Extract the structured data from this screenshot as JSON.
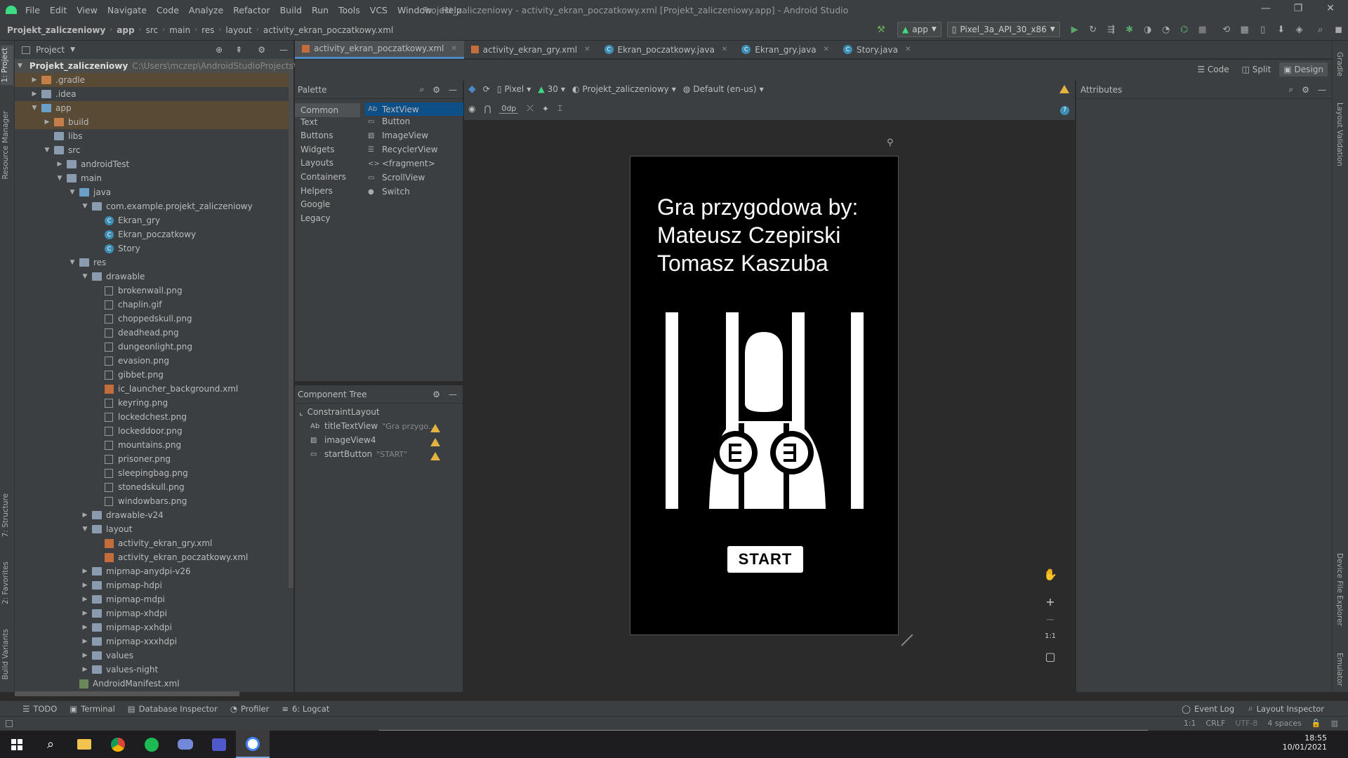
{
  "window": {
    "menu": [
      "File",
      "Edit",
      "View",
      "Navigate",
      "Code",
      "Analyze",
      "Refactor",
      "Build",
      "Run",
      "Tools",
      "VCS",
      "Window",
      "Help"
    ],
    "title": "Projekt_zaliczeniowy - activity_ekran_poczatkowy.xml [Projekt_zaliczeniowy.app] - Android Studio"
  },
  "navbar": {
    "breadcrumbs": [
      "Projekt_zaliczeniowy",
      "app",
      "src",
      "main",
      "res",
      "layout",
      "activity_ekran_poczatkowy.xml"
    ],
    "run_config": "app",
    "device": "Pixel_3a_API_30_x86"
  },
  "left_strip": {
    "project": "1: Project",
    "resource_manager": "Resource Manager",
    "structure": "7: Structure",
    "favorites": "2: Favorites",
    "build_variants": "Build Variants"
  },
  "right_strip": {
    "gradle": "Gradle",
    "layout_validation": "Layout Validation",
    "device_file_explorer": "Device File Explorer",
    "emulator": "Emulator"
  },
  "project_panel": {
    "title": "Project",
    "root": "Projekt_zaliczeniowy",
    "root_path": "C:\\Users\\mczep\\AndroidStudioProjects\\Pro",
    "tree": [
      {
        "label": ".gradle",
        "depth": 1,
        "kind": "folder-orange",
        "arrow": "▶"
      },
      {
        "label": ".idea",
        "depth": 1,
        "kind": "folder",
        "arrow": "▶"
      },
      {
        "label": "app",
        "depth": 1,
        "kind": "folder-src",
        "arrow": "▼"
      },
      {
        "label": "build",
        "depth": 2,
        "kind": "folder-orange",
        "arrow": "▶"
      },
      {
        "label": "libs",
        "depth": 2,
        "kind": "folder",
        "arrow": ""
      },
      {
        "label": "src",
        "depth": 2,
        "kind": "folder",
        "arrow": "▼"
      },
      {
        "label": "androidTest",
        "depth": 3,
        "kind": "folder",
        "arrow": "▶"
      },
      {
        "label": "main",
        "depth": 3,
        "kind": "folder",
        "arrow": "▼"
      },
      {
        "label": "java",
        "depth": 4,
        "kind": "folder-src",
        "arrow": "▼"
      },
      {
        "label": "com.example.projekt_zaliczeniowy",
        "depth": 5,
        "kind": "folder",
        "arrow": "▼"
      },
      {
        "label": "Ekran_gry",
        "depth": 6,
        "kind": "class",
        "arrow": ""
      },
      {
        "label": "Ekran_poczatkowy",
        "depth": 6,
        "kind": "class",
        "arrow": ""
      },
      {
        "label": "Story",
        "depth": 6,
        "kind": "class",
        "arrow": ""
      },
      {
        "label": "res",
        "depth": 4,
        "kind": "folder",
        "arrow": "▼"
      },
      {
        "label": "drawable",
        "depth": 5,
        "kind": "folder",
        "arrow": "▼"
      },
      {
        "label": "brokenwall.png",
        "depth": 6,
        "kind": "image",
        "arrow": ""
      },
      {
        "label": "chaplin.gif",
        "depth": 6,
        "kind": "image",
        "arrow": ""
      },
      {
        "label": "choppedskull.png",
        "depth": 6,
        "kind": "image",
        "arrow": ""
      },
      {
        "label": "deadhead.png",
        "depth": 6,
        "kind": "image",
        "arrow": ""
      },
      {
        "label": "dungeonlight.png",
        "depth": 6,
        "kind": "image",
        "arrow": ""
      },
      {
        "label": "evasion.png",
        "depth": 6,
        "kind": "image",
        "arrow": ""
      },
      {
        "label": "gibbet.png",
        "depth": 6,
        "kind": "image",
        "arrow": ""
      },
      {
        "label": "ic_launcher_background.xml",
        "depth": 6,
        "kind": "xml",
        "arrow": ""
      },
      {
        "label": "keyring.png",
        "depth": 6,
        "kind": "image",
        "arrow": ""
      },
      {
        "label": "lockedchest.png",
        "depth": 6,
        "kind": "image",
        "arrow": ""
      },
      {
        "label": "lockeddoor.png",
        "depth": 6,
        "kind": "image",
        "arrow": ""
      },
      {
        "label": "mountains.png",
        "depth": 6,
        "kind": "image",
        "arrow": ""
      },
      {
        "label": "prisoner.png",
        "depth": 6,
        "kind": "image",
        "arrow": ""
      },
      {
        "label": "sleepingbag.png",
        "depth": 6,
        "kind": "image",
        "arrow": ""
      },
      {
        "label": "stonedskull.png",
        "depth": 6,
        "kind": "image",
        "arrow": ""
      },
      {
        "label": "windowbars.png",
        "depth": 6,
        "kind": "image",
        "arrow": ""
      },
      {
        "label": "drawable-v24",
        "depth": 5,
        "kind": "folder",
        "arrow": "▶"
      },
      {
        "label": "layout",
        "depth": 5,
        "kind": "folder",
        "arrow": "▼"
      },
      {
        "label": "activity_ekran_gry.xml",
        "depth": 6,
        "kind": "xml",
        "arrow": ""
      },
      {
        "label": "activity_ekran_poczatkowy.xml",
        "depth": 6,
        "kind": "xml",
        "arrow": ""
      },
      {
        "label": "mipmap-anydpi-v26",
        "depth": 5,
        "kind": "folder",
        "arrow": "▶"
      },
      {
        "label": "mipmap-hdpi",
        "depth": 5,
        "kind": "folder",
        "arrow": "▶"
      },
      {
        "label": "mipmap-mdpi",
        "depth": 5,
        "kind": "folder",
        "arrow": "▶"
      },
      {
        "label": "mipmap-xhdpi",
        "depth": 5,
        "kind": "folder",
        "arrow": "▶"
      },
      {
        "label": "mipmap-xxhdpi",
        "depth": 5,
        "kind": "folder",
        "arrow": "▶"
      },
      {
        "label": "mipmap-xxxhdpi",
        "depth": 5,
        "kind": "folder",
        "arrow": "▶"
      },
      {
        "label": "values",
        "depth": 5,
        "kind": "folder",
        "arrow": "▶"
      },
      {
        "label": "values-night",
        "depth": 5,
        "kind": "folder",
        "arrow": "▶"
      },
      {
        "label": "AndroidManifest.xml",
        "depth": 4,
        "kind": "manifest",
        "arrow": ""
      }
    ]
  },
  "tabs": [
    {
      "label": "activity_ekran_poczatkowy.xml",
      "kind": "xml",
      "active": true
    },
    {
      "label": "activity_ekran_gry.xml",
      "kind": "xml",
      "active": false
    },
    {
      "label": "Ekran_poczatkowy.java",
      "kind": "class",
      "active": false
    },
    {
      "label": "Ekran_gry.java",
      "kind": "class",
      "active": false
    },
    {
      "label": "Story.java",
      "kind": "class",
      "active": false
    }
  ],
  "view_modes": {
    "code": "Code",
    "split": "Split",
    "design": "Design"
  },
  "palette": {
    "title": "Palette",
    "categories": [
      "Common",
      "Text",
      "Buttons",
      "Widgets",
      "Layouts",
      "Containers",
      "Helpers",
      "Google",
      "Legacy"
    ],
    "items": [
      {
        "icon": "Ab",
        "label": "TextView"
      },
      {
        "icon": "▭",
        "label": "Button"
      },
      {
        "icon": "▨",
        "label": "ImageView"
      },
      {
        "icon": "☰",
        "label": "RecyclerView"
      },
      {
        "icon": "<>",
        "label": "<fragment>"
      },
      {
        "icon": "▭",
        "label": "ScrollView"
      },
      {
        "icon": "●",
        "label": "Switch"
      }
    ]
  },
  "component_tree": {
    "title": "Component Tree",
    "root": "ConstraintLayout",
    "items": [
      {
        "icon": "Ab",
        "label": "titleTextView",
        "hint": "\"Gra przygo...",
        "warning": true
      },
      {
        "icon": "▨",
        "label": "imageView4",
        "hint": "",
        "warning": true
      },
      {
        "icon": "▭",
        "label": "startButton",
        "hint": "\"START\"",
        "warning": true
      }
    ]
  },
  "design_toolbar": {
    "device": "Pixel",
    "api": "30",
    "theme": "Projekt_zaliczeniowy",
    "locale": "Default (en-us)",
    "margin": "0dp"
  },
  "preview": {
    "title": "Gra przygodowa by:\nMateusz Czepirski\nTomasz Kaszuba",
    "button": "START"
  },
  "zoom": {
    "ratio": "1:1"
  },
  "attributes": {
    "title": "Attributes"
  },
  "bottom_tools": [
    {
      "icon": "☰",
      "label": "TODO"
    },
    {
      "icon": "▣",
      "label": "Terminal"
    },
    {
      "icon": "▤",
      "label": "Database Inspector"
    },
    {
      "icon": "◔",
      "label": "Profiler"
    },
    {
      "icon": "≡",
      "label": "6: Logcat"
    }
  ],
  "bottom_right_tools": [
    {
      "icon": "◯",
      "label": "Event Log"
    },
    {
      "icon": "⌕",
      "label": "Layout Inspector"
    }
  ],
  "status": {
    "position": "1:1",
    "line_sep": "CRLF",
    "encoding": "UTF-8",
    "indent": "4 spaces"
  },
  "taskbar": {
    "time": "18:55",
    "date": "10/01/2021"
  },
  "colors": {
    "accent": "#4a88c7",
    "warning": "#e3b341",
    "android_green": "#3ddc84"
  }
}
